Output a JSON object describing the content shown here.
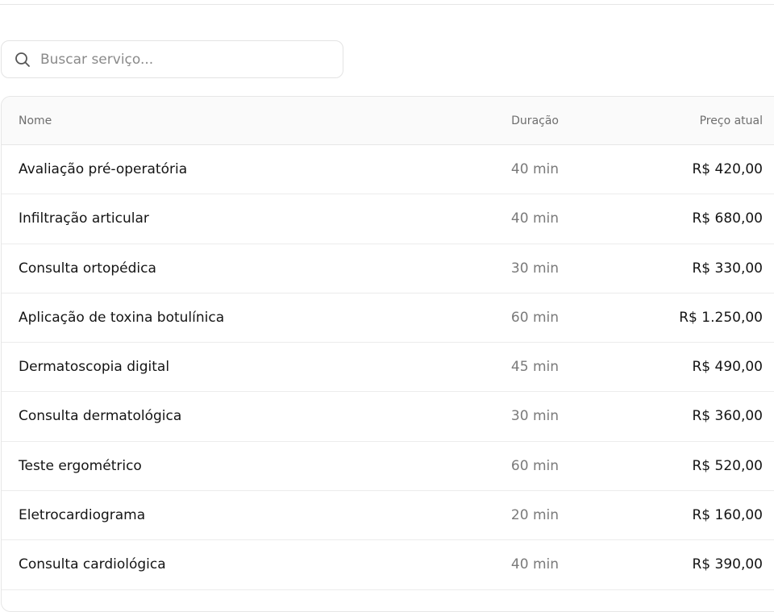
{
  "search": {
    "placeholder": "Buscar serviço...",
    "value": "",
    "icon": "search-icon"
  },
  "table": {
    "columns": {
      "name": "Nome",
      "duration": "Duração",
      "price": "Preço atual"
    },
    "rows": [
      {
        "name": "Avaliação pré-operatória",
        "duration": "40 min",
        "price": "R$ 420,00"
      },
      {
        "name": "Infiltração articular",
        "duration": "40 min",
        "price": "R$ 680,00"
      },
      {
        "name": "Consulta ortopédica",
        "duration": "30 min",
        "price": "R$ 330,00"
      },
      {
        "name": "Aplicação de toxina botulínica",
        "duration": "60 min",
        "price": "R$ 1.250,00"
      },
      {
        "name": "Dermatoscopia digital",
        "duration": "45 min",
        "price": "R$ 490,00"
      },
      {
        "name": "Consulta dermatológica",
        "duration": "30 min",
        "price": "R$ 360,00"
      },
      {
        "name": "Teste ergométrico",
        "duration": "60 min",
        "price": "R$ 520,00"
      },
      {
        "name": "Eletrocardiograma",
        "duration": "20 min",
        "price": "R$ 160,00"
      },
      {
        "name": "Consulta cardiológica",
        "duration": "40 min",
        "price": "R$ 390,00"
      }
    ]
  }
}
